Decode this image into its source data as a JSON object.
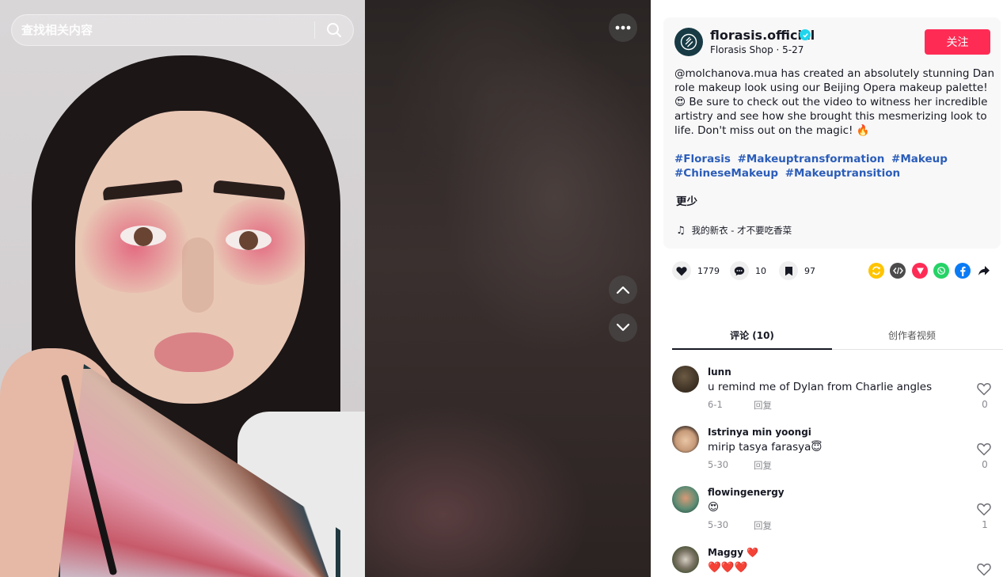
{
  "search": {
    "placeholder": "查找相关内容"
  },
  "creator": {
    "name": "florasis.official",
    "shop": "Florasis Shop",
    "date": "5-27",
    "follow_label": "关注"
  },
  "caption": "@molchanova.mua has created an absolutely stunning Dan role makeup look using our Beijing Opera makeup palette! 😍 Be sure to check out the video to witness her incredible artistry and see how she brought this mesmerizing look to life. Don't miss out on the magic! 🔥",
  "hashtags": [
    "#Florasis",
    "#Makeuptransformation",
    "#Makeup",
    "#ChineseMakeup",
    "#Makeuptransition"
  ],
  "less_label": "更少",
  "music": "我的新衣 - 才不要吃香菜",
  "actions": {
    "likes": "1779",
    "comments": "10",
    "saves": "97"
  },
  "share_icons": [
    "repost-icon",
    "embed-icon",
    "send-icon",
    "whatsapp-icon",
    "facebook-icon",
    "share-arrow-icon"
  ],
  "tabs": [
    "评论 (10)",
    "创作者视频"
  ],
  "comments": [
    {
      "user": "lunn",
      "text": "u remind me of Dylan from Charlie angles",
      "date": "6-1",
      "reply": "回复",
      "likes": "0"
    },
    {
      "user": "Istrinya min yoongi",
      "text": "mirip tasya farasya😇",
      "date": "5-30",
      "reply": "回复",
      "likes": "0"
    },
    {
      "user": "flowingenergy",
      "text": "😍",
      "date": "5-30",
      "reply": "回复",
      "likes": "1"
    },
    {
      "user": "Maggy ❤️",
      "text": "❤️❤️❤️",
      "date": "",
      "reply": "",
      "likes": ""
    }
  ],
  "colors": {
    "accent": "#fe2c55",
    "hashtag": "#2b5db9",
    "verified": "#20d5ec"
  }
}
